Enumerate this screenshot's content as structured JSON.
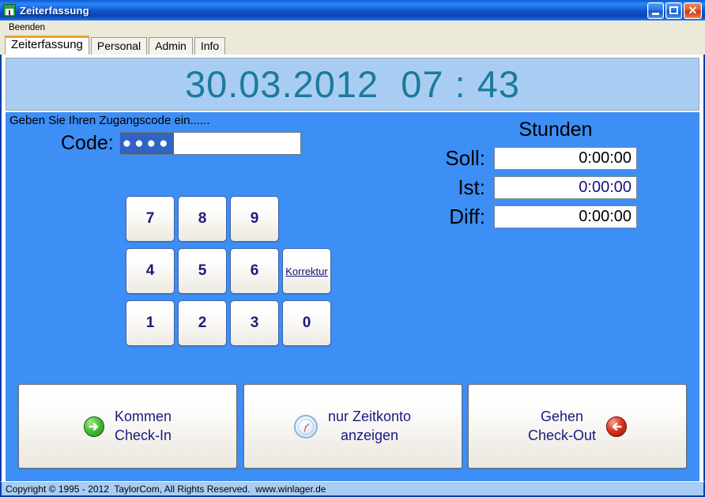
{
  "window": {
    "title": "Zeiterfassung",
    "icon": "calendar-icon",
    "minimize_label": "",
    "maximize_label": "",
    "close_label": "✕"
  },
  "menu": {
    "items": [
      {
        "label": "Beenden"
      }
    ]
  },
  "tabs": [
    {
      "label": "Zeiterfassung",
      "active": true
    },
    {
      "label": "Personal",
      "active": false
    },
    {
      "label": "Admin",
      "active": false
    },
    {
      "label": "Info",
      "active": false
    }
  ],
  "clock": {
    "display": "30.03.2012  07 : 43",
    "color": "#1b7a9e"
  },
  "main": {
    "hint": "Geben Sie Ihren Zugangscode ein......",
    "code": {
      "label": "Code:",
      "value": "●●●●",
      "placeholder": "",
      "selected": true
    },
    "keypad": [
      {
        "label": "7",
        "kind": "digit"
      },
      {
        "label": "8",
        "kind": "digit"
      },
      {
        "label": "9",
        "kind": "digit"
      },
      {
        "label": "",
        "kind": "empty"
      },
      {
        "label": "4",
        "kind": "digit"
      },
      {
        "label": "5",
        "kind": "digit"
      },
      {
        "label": "6",
        "kind": "digit"
      },
      {
        "label": "Korrektur",
        "kind": "korrektur"
      },
      {
        "label": "1",
        "kind": "digit"
      },
      {
        "label": "2",
        "kind": "digit"
      },
      {
        "label": "3",
        "kind": "digit"
      },
      {
        "label": "0",
        "kind": "digit"
      }
    ],
    "stunden": {
      "title": "Stunden",
      "rows": [
        {
          "label": "Soll:",
          "value": "0:00:00"
        },
        {
          "label": "Ist:",
          "value": "0:00:00"
        },
        {
          "label": "Diff:",
          "value": "0:00:00"
        }
      ]
    },
    "actions": [
      {
        "label": "Kommen\nCheck-In",
        "icon": "arrow-right-circle-green-icon",
        "icon_side": "left"
      },
      {
        "label": "nur Zeitkonto\nanzeigen",
        "icon": "clock-icon",
        "icon_side": "left"
      },
      {
        "label": "Gehen\nCheck-Out",
        "icon": "arrow-left-circle-red-icon",
        "icon_side": "right"
      }
    ]
  },
  "statusbar": {
    "text": "Copyright © 1995 - 2012  TaylorCom, All Rights Reserved.  www.winlager.de"
  },
  "colors": {
    "background_blue": "#3d8ef5",
    "panel_blue": "#a9cdf2",
    "accent_orange": "#f0a030",
    "clock_teal": "#1b7a9e",
    "navy_text": "#1a1a80"
  }
}
